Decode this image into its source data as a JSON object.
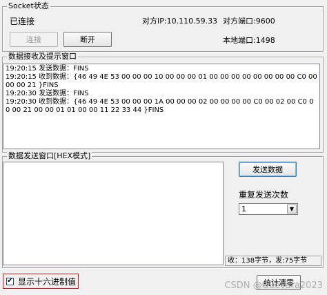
{
  "socket_group": {
    "title": "Socket状态",
    "status": "已连接",
    "remote_ip": "对方IP:10.110.59.33",
    "remote_port": "对方端口:9600",
    "local_port": "本地端口:1498",
    "connect_label": "连接",
    "disconnect_label": "断开"
  },
  "log_group": {
    "title": "数据接收及提示窗口",
    "lines": [
      "19:20:15 发送数据：FINS",
      "19:20:15 收到数据：{46 49 4E 53 00 00 00 10 00 00 00 01 00 00 00 00 00 00 00 00 C0 00 00 00 21 }FINS",
      "19:20:30 发送数据：FINS",
      "19:20:30 收到数据：{46 49 4E 53 00 00 00 1A 00 00 00 02 00 00 00 00 C0 00 02 00 C0 00 00 21 00 00 01 01 00 00 11 22 33 44 }FINS"
    ]
  },
  "send_group": {
    "title": "数据发送窗口[HEX模式]",
    "input_value": "",
    "send_button_label": "发送数据",
    "repeat_label": "重复发送次数",
    "repeat_value": "1",
    "stats_text": "收：138字节，发:75字节"
  },
  "footer": {
    "hex_display_label": "显示十六进制值",
    "hex_display_checked": true,
    "clear_stats_label": "统计清零",
    "watermark": "CSDN @Guevara2023"
  },
  "colors": {
    "window_bg": "#f0f0f0",
    "highlight_border": "#d01010"
  }
}
